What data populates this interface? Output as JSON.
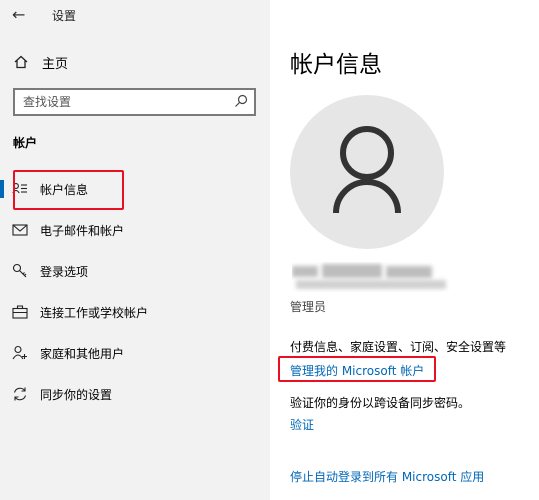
{
  "window": {
    "title": "设置"
  },
  "sidebar": {
    "home_label": "主页",
    "search": {
      "placeholder": "查找设置"
    },
    "section_title": "帐户",
    "items": [
      {
        "label": "帐户信息",
        "icon": "account-info-icon",
        "active": true
      },
      {
        "label": "电子邮件和帐户",
        "icon": "mail-icon"
      },
      {
        "label": "登录选项",
        "icon": "key-icon"
      },
      {
        "label": "连接工作或学校帐户",
        "icon": "briefcase-icon"
      },
      {
        "label": "家庭和其他用户",
        "icon": "person-add-icon"
      },
      {
        "label": "同步你的设置",
        "icon": "sync-icon"
      }
    ]
  },
  "main": {
    "title": "帐户信息",
    "role": "管理员",
    "billing_text": "付费信息、家庭设置、订阅、安全设置等",
    "manage_link": "管理我的 Microsoft 帐户",
    "verify_text": "验证你的身份以跨设备同步密码。",
    "verify_link": "验证",
    "stop_link": "停止自动登录到所有 Microsoft 应用"
  },
  "colors": {
    "accent": "#0067b8",
    "highlight": "#e81123",
    "sidebar_bg": "#f2f2f2"
  }
}
